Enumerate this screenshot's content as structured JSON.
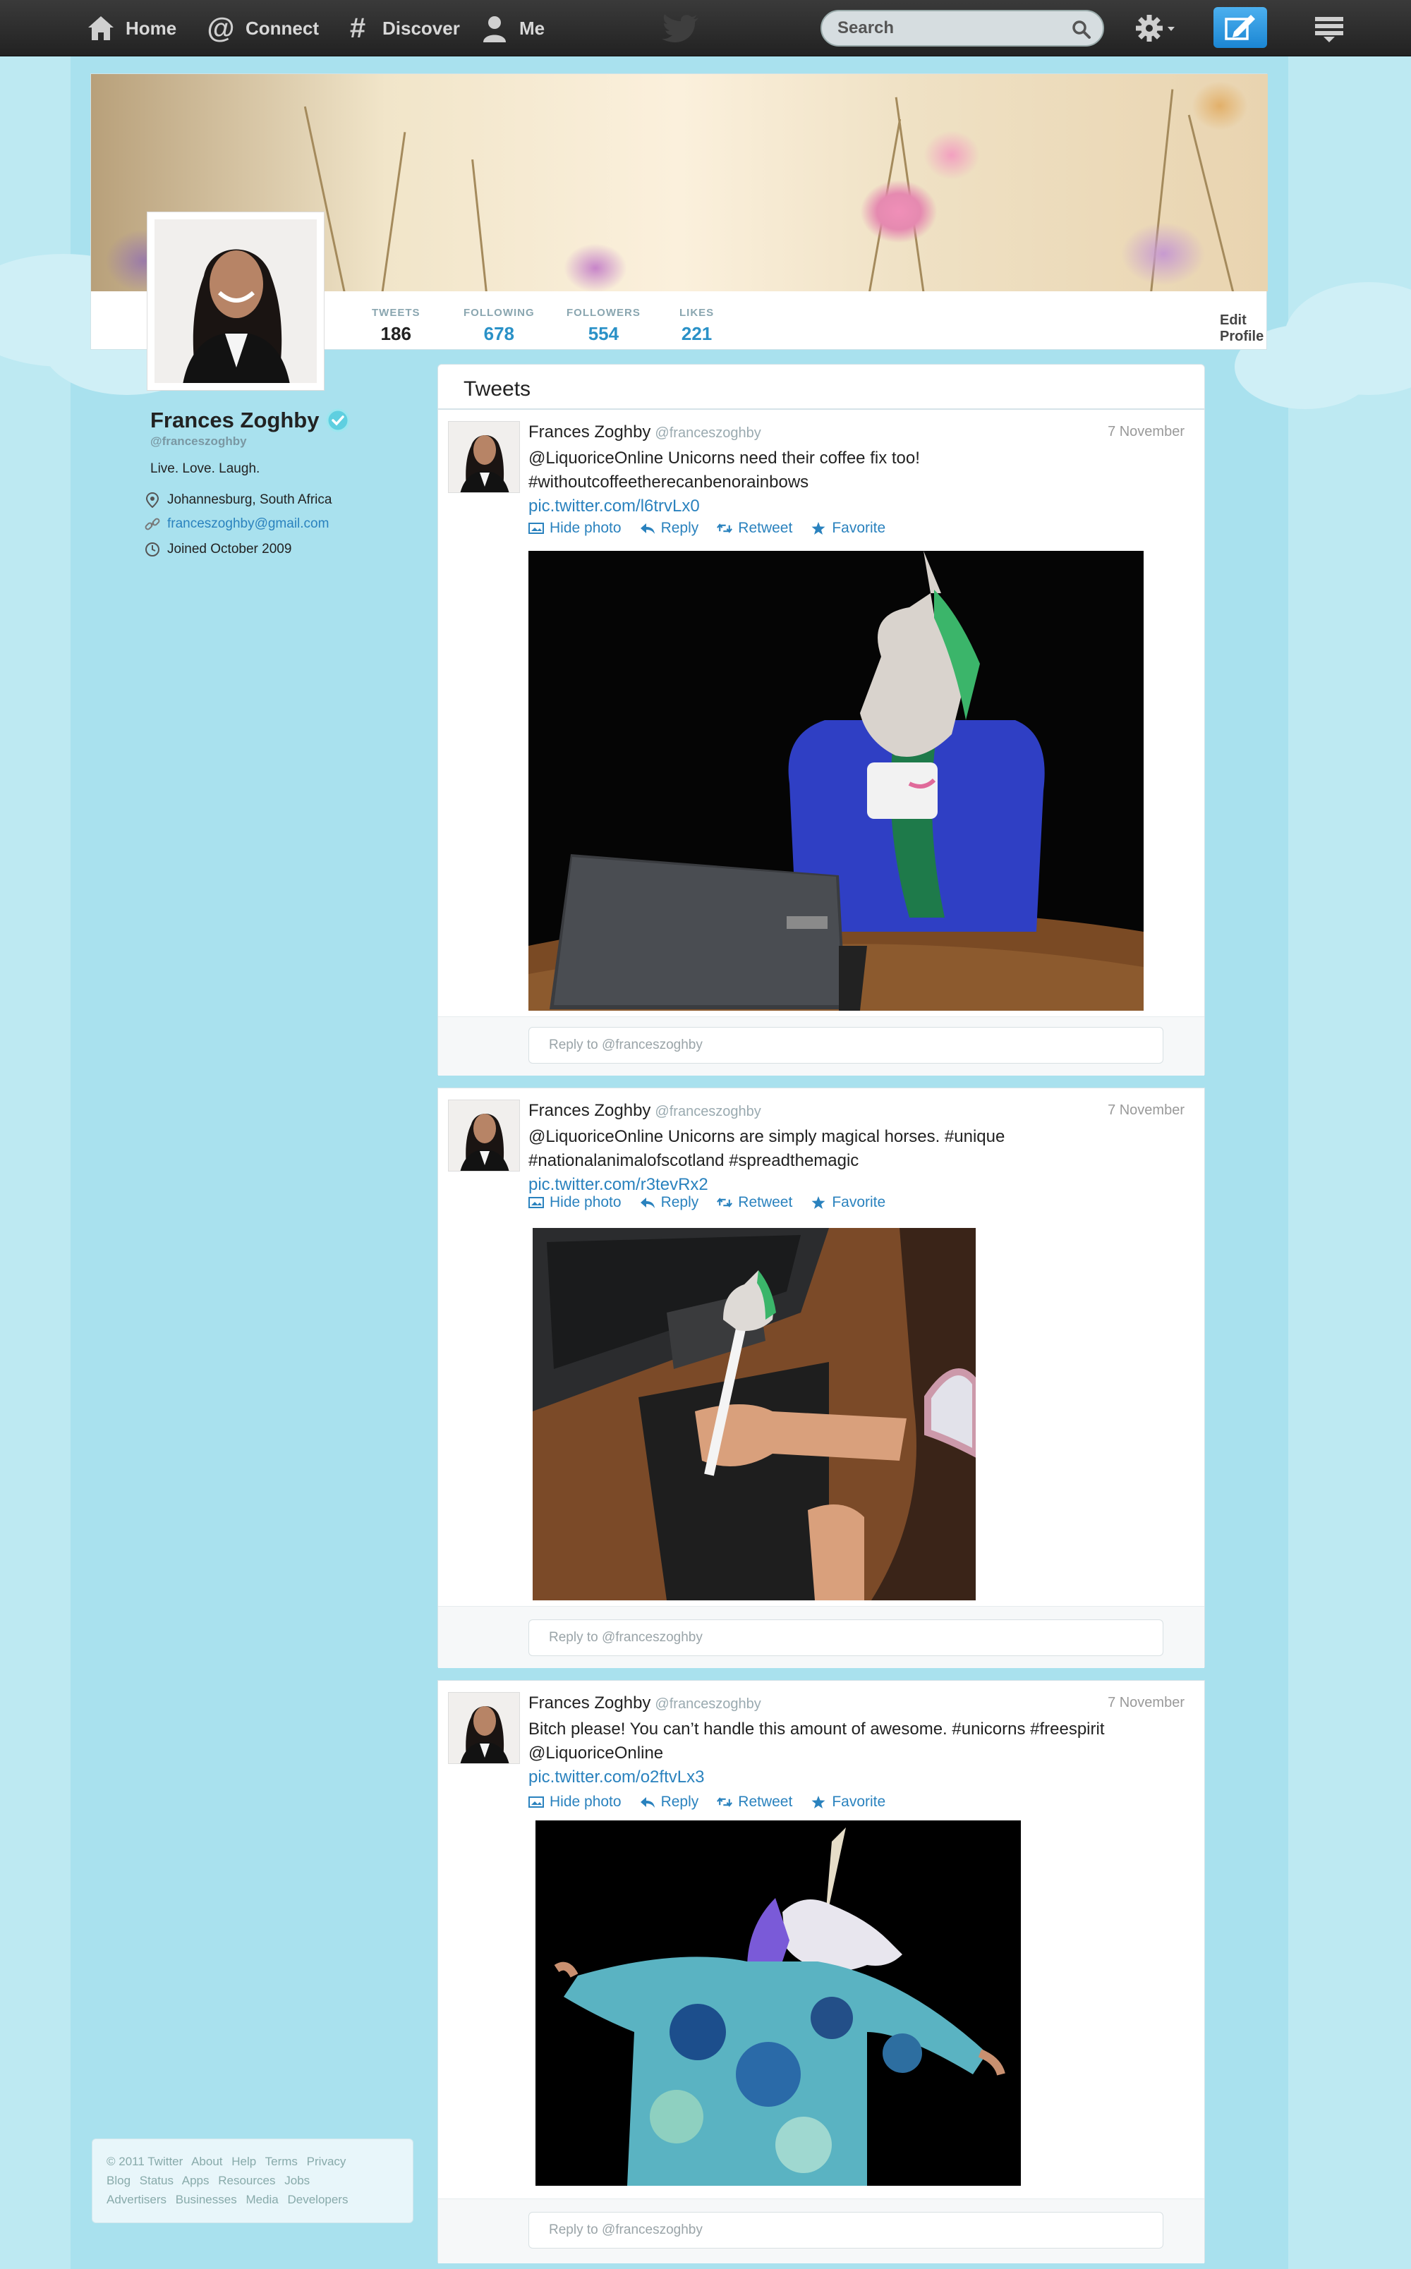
{
  "nav": {
    "home": "Home",
    "connect": "Connect",
    "discover": "Discover",
    "me": "Me",
    "search_placeholder": "Search"
  },
  "profile": {
    "name": "Frances Zoghby",
    "handle": "@franceszoghby",
    "bio": "Live. Love. Laugh.",
    "location": "Johannesburg, South Africa",
    "email": "franceszoghby@gmail.com",
    "joined": "Joined October 2009",
    "edit_label": "Edit Profile",
    "stats": [
      {
        "label": "TWEETS",
        "value": "186"
      },
      {
        "label": "FOLLOWING",
        "value": "678"
      },
      {
        "label": "FOLLOWERS",
        "value": "554"
      },
      {
        "label": "LIKES",
        "value": "221"
      }
    ]
  },
  "tweets_heading": "Tweets",
  "tweets": [
    {
      "name": "Frances Zoghby",
      "handle": "@franceszoghby",
      "date": "7 November",
      "line1": "@LiquoriceOnline Unicorns need their coffee fix too!",
      "line2": "#withoutcoffeetherecanbenorainbows",
      "link": "pic.twitter.com/l6trvLx0",
      "hide_photo": "Hide photo",
      "reply": "Reply",
      "retweet": "Retweet",
      "favorite": "Favorite",
      "reply_placeholder": "Reply to @franceszoghby"
    },
    {
      "name": "Frances Zoghby",
      "handle": "@franceszoghby",
      "date": "7 November",
      "line1": "@LiquoriceOnline Unicorns are simply magical horses. #unique",
      "line2": "#nationalanimalofscotland #spreadthemagic",
      "link": "pic.twitter.com/r3tevRx2",
      "hide_photo": "Hide photo",
      "reply": "Reply",
      "retweet": "Retweet",
      "favorite": "Favorite",
      "reply_placeholder": "Reply to @franceszoghby"
    },
    {
      "name": "Frances Zoghby",
      "handle": "@franceszoghby",
      "date": "7 November",
      "line1": "Bitch please! You can’t handle this amount of awesome. #unicorns #freespirit",
      "line2": "@LiquoriceOnline",
      "link": "pic.twitter.com/o2ftvLx3",
      "hide_photo": "Hide photo",
      "reply": "Reply",
      "retweet": "Retweet",
      "favorite": "Favorite",
      "reply_placeholder": "Reply to @franceszoghby"
    }
  ],
  "footer": {
    "row1": [
      "© 2011 Twitter",
      "About",
      "Help",
      "Terms",
      "Privacy"
    ],
    "row2": [
      "Blog",
      "Status",
      "Apps",
      "Resources",
      "Jobs"
    ],
    "row3": [
      "Advertisers",
      "Businesses",
      "Media",
      "Developers"
    ]
  },
  "colors": {
    "accent": "#2a82be",
    "background": "#bde9f2",
    "topbar": "#2b2b2b"
  }
}
